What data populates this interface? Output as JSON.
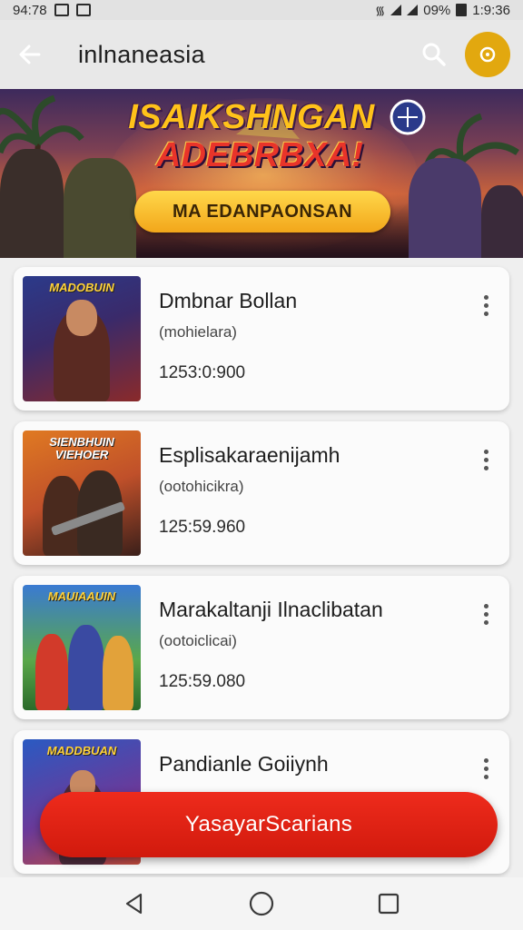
{
  "status_bar": {
    "time_left": "94:78",
    "battery": "09%",
    "time_right": "1:9:36"
  },
  "app_bar": {
    "title": "inlnaneasia",
    "back_icon": "arrow-left-icon",
    "search_icon": "search-icon",
    "profile_icon": "location-pin-icon"
  },
  "banner": {
    "headline_line1": "ISAIKSHNGAN",
    "headline_line2": "ADEBRBXA!",
    "cta_label": "MA EDANPAONSAN"
  },
  "items": [
    {
      "thumb_text": "MADOBUIN",
      "title": "Dmbnar Bollan",
      "subtitle": "(mohielara)",
      "number": "1253:0:900"
    },
    {
      "thumb_text": "SIENBHUIN VIEHOER",
      "title": "Esplisakaraenijamh",
      "subtitle": "(ootohicikra)",
      "number": "125:59.960"
    },
    {
      "thumb_text": "MAUIAAUIN",
      "title": "Marakaltanji Ilnaclibatan",
      "subtitle": "(ootoiclicai)",
      "number": "125:59.080"
    },
    {
      "thumb_text": "MADDBUAN",
      "title": "Pandianle Goiiynh",
      "subtitle": "",
      "number": ""
    }
  ],
  "fab": {
    "label": "YasayarScarians"
  },
  "colors": {
    "accent_red": "#e0241a",
    "accent_gold": "#e2a80f",
    "banner_cta": "#f4b223"
  },
  "nav_bar": {
    "back_icon": "nav-back-icon",
    "home_icon": "nav-home-icon",
    "recents_icon": "nav-recents-icon"
  }
}
